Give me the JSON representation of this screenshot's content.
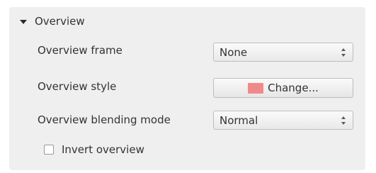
{
  "group": {
    "title": "Overview",
    "expanded": true
  },
  "rows": [
    {
      "label": "Overview frame",
      "control": "combo",
      "value": "None"
    },
    {
      "label": "Overview style",
      "control": "button",
      "value": "Change..."
    },
    {
      "label": "Overview blending mode",
      "control": "combo",
      "value": "Normal"
    }
  ],
  "style_swatch_color": "#f08a8a",
  "invert_overview": {
    "label": "Invert overview",
    "checked": false
  }
}
